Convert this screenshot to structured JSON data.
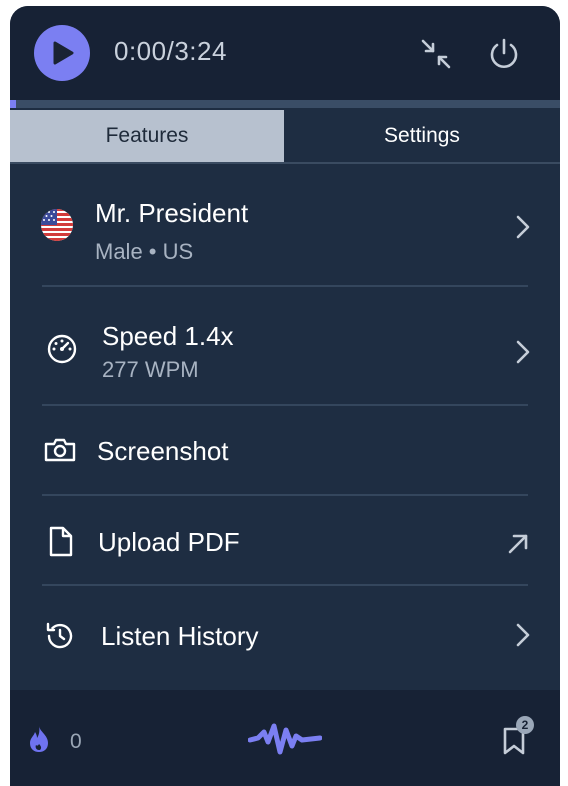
{
  "player": {
    "time": "0:00/3:24",
    "progress": 0.01,
    "accent_color": "#7b7ff2"
  },
  "tabs": [
    {
      "label": "Features",
      "active": true
    },
    {
      "label": "Settings",
      "active": false
    }
  ],
  "features": {
    "voice": {
      "name": "Mr. President",
      "detail": "Male • US",
      "icon": "us-flag-icon"
    },
    "speed": {
      "label": "Speed 1.4x",
      "wpm": "277 WPM",
      "icon": "speedometer-icon"
    },
    "screenshot": {
      "label": "Screenshot",
      "icon": "camera-icon"
    },
    "upload": {
      "label": "Upload PDF",
      "icon": "document-icon"
    },
    "history": {
      "label": "Listen History",
      "icon": "history-icon"
    }
  },
  "footer": {
    "streak_count": "0",
    "bookmark_count": "2",
    "logo": "speechify-logo"
  }
}
